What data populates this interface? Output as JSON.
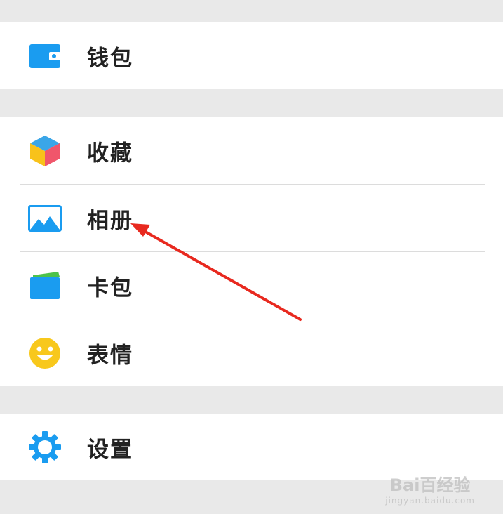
{
  "menu": {
    "wallet": {
      "label": "钱包",
      "icon": "wallet-icon"
    },
    "favorites": {
      "label": "收藏",
      "icon": "cube-icon"
    },
    "album": {
      "label": "相册",
      "icon": "picture-icon"
    },
    "cards": {
      "label": "卡包",
      "icon": "card-icon"
    },
    "stickers": {
      "label": "表情",
      "icon": "smiley-icon"
    },
    "settings": {
      "label": "设置",
      "icon": "gear-icon"
    }
  },
  "colors": {
    "accent_blue": "#1a9cf0",
    "arrow_red": "#e8291f",
    "background": "#e9e9e9"
  },
  "watermark": {
    "brand": "Bai百经验",
    "url": "jingyan.baidu.com"
  }
}
